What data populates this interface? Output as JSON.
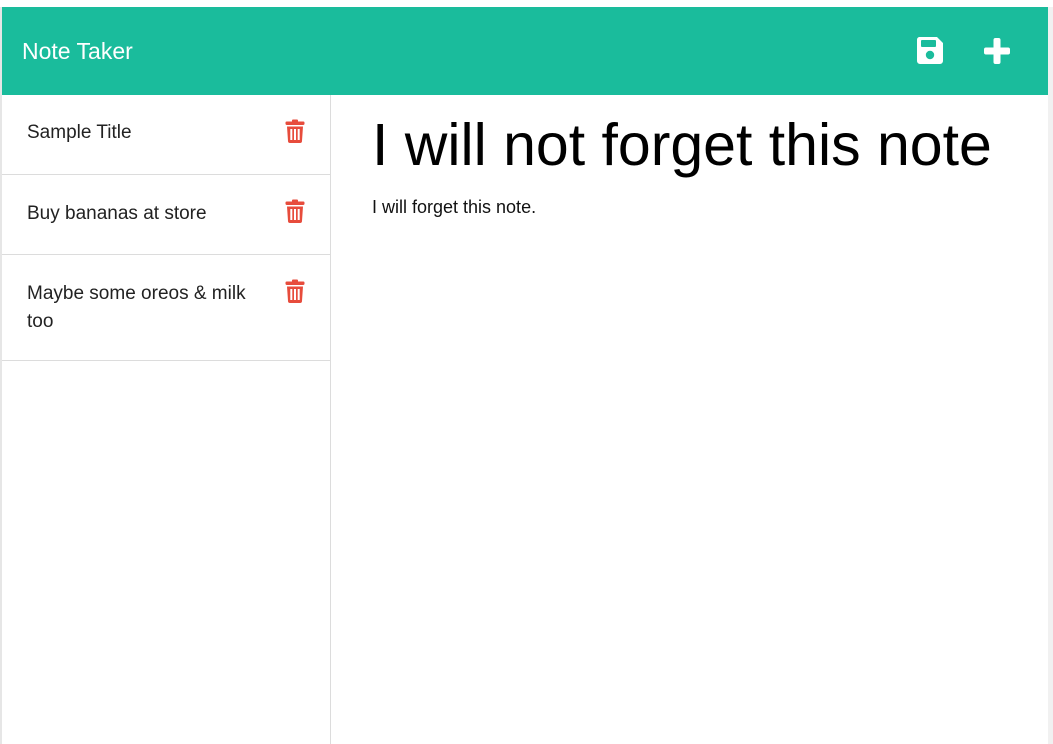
{
  "navbar": {
    "brand": "Note Taker",
    "background": "#1abc9c",
    "save_icon": "floppy-disk-icon",
    "new_icon": "plus-icon"
  },
  "notes": [
    {
      "title": "Sample Title",
      "icon": "trash-icon"
    },
    {
      "title": "Buy bananas at store",
      "icon": "trash-icon"
    },
    {
      "title": "Maybe some oreos & milk too",
      "icon": "trash-icon"
    }
  ],
  "active_note": {
    "title": "I will not forget this note",
    "text": "I will forget this note."
  },
  "colors": {
    "accent": "#1abc9c",
    "delete": "#e74c3c"
  }
}
